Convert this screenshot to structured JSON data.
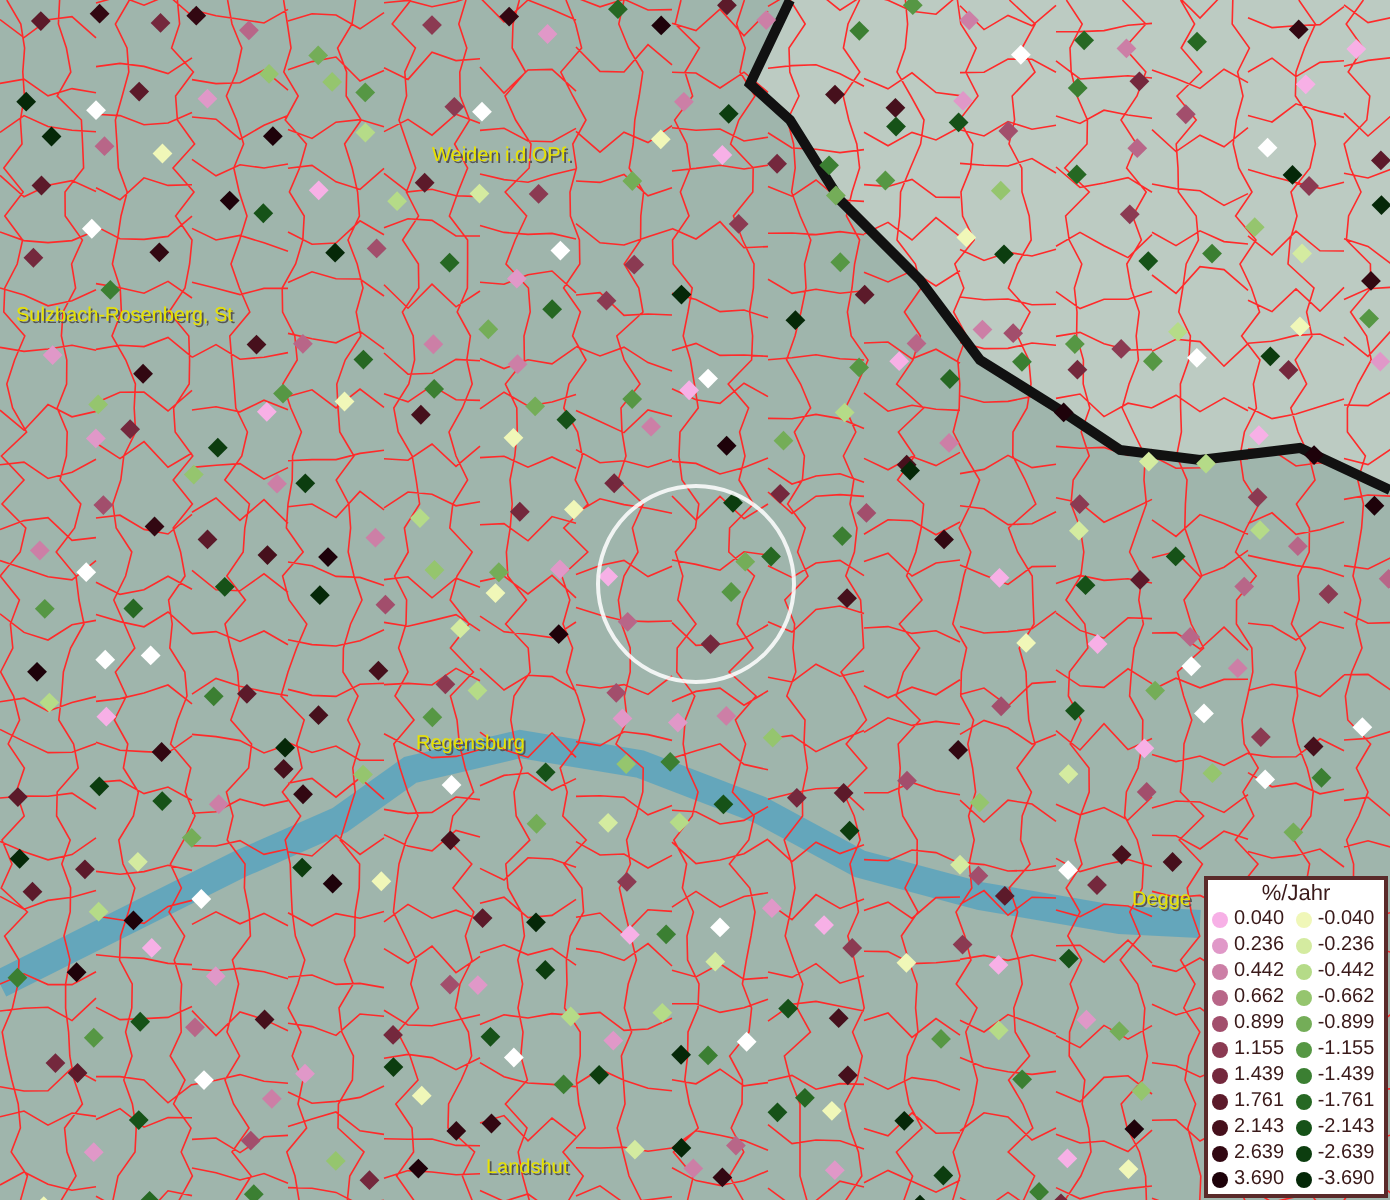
{
  "map": {
    "places": [
      {
        "name": "Weiden i.d.OPf."
      },
      {
        "name": "Sulzbach-Rosenberg, St"
      },
      {
        "name": "Regensburg"
      },
      {
        "name": "Degge"
      },
      {
        "name": "Landshut"
      }
    ]
  },
  "legend": {
    "title": "%/Jahr",
    "rows": [
      {
        "positive": {
          "label": "0.040",
          "color": "#f7b0e6"
        },
        "negative": {
          "label": "-0.040",
          "color": "#f0f7b8"
        }
      },
      {
        "positive": {
          "label": "0.236",
          "color": "#e098c8"
        },
        "negative": {
          "label": "-0.236",
          "color": "#d4eba0"
        }
      },
      {
        "positive": {
          "label": "0.442",
          "color": "#cc7fa6"
        },
        "negative": {
          "label": "-0.442",
          "color": "#b5db88"
        }
      },
      {
        "positive": {
          "label": "0.662",
          "color": "#b86688"
        },
        "negative": {
          "label": "-0.662",
          "color": "#95c56e"
        }
      },
      {
        "positive": {
          "label": "0.899",
          "color": "#a24e6c"
        },
        "negative": {
          "label": "-0.899",
          "color": "#74ad58"
        }
      },
      {
        "positive": {
          "label": "1.155",
          "color": "#8b3a52"
        },
        "negative": {
          "label": "-1.155",
          "color": "#569744"
        }
      },
      {
        "positive": {
          "label": "1.439",
          "color": "#74283d"
        },
        "negative": {
          "label": "-1.439",
          "color": "#3b7f32"
        }
      },
      {
        "positive": {
          "label": "1.761",
          "color": "#5c1a2a"
        },
        "negative": {
          "label": "-1.761",
          "color": "#266823"
        }
      },
      {
        "positive": {
          "label": "2.143",
          "color": "#46101c"
        },
        "negative": {
          "label": "-2.143",
          "color": "#165218"
        }
      },
      {
        "positive": {
          "label": "2.639",
          "color": "#320812"
        },
        "negative": {
          "label": "-2.639",
          "color": "#0c3d0f"
        }
      },
      {
        "positive": {
          "label": "3.690",
          "color": "#1e020a"
        },
        "negative": {
          "label": "-3.690",
          "color": "#052808"
        }
      }
    ]
  }
}
